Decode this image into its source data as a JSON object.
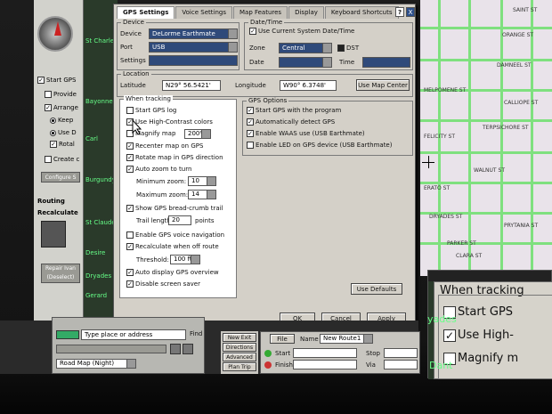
{
  "background_left": {
    "start_gps": "Start GPS",
    "provide": "Provide",
    "arrange": "Arrange",
    "keep": "Keep",
    "use_d": "Use D",
    "rotal": "Rotal",
    "create": "Create c",
    "configure": "Configure S",
    "routing": "Routing",
    "recalc": "Recalculate",
    "repair_btn": "Repair Ivan (Deselect)",
    "map_labels": [
      "St Charles",
      "Bayonne",
      "Carl",
      "Burgundy",
      "St Claude",
      "Desire",
      "Dryades",
      "Gerard"
    ]
  },
  "right_map": {
    "labels": [
      "ORANGE ST",
      "DAMNEEL ST",
      "FELICITY ST",
      "ERATO ST",
      "CLARA ST",
      "CALLIOPE ST",
      "WALNUT ST",
      "PRYTANIA ST",
      "DRYADES ST",
      "MELPOMENE ST",
      "TERPSICHORE ST",
      "SAINT ST",
      "PARKER ST"
    ]
  },
  "dialog": {
    "tabs": [
      "GPS Settings",
      "Voice Settings",
      "Map Features",
      "Display",
      "Keyboard Shortcuts"
    ],
    "help": "?",
    "close": "X",
    "device_group": "Device",
    "device_label": "Device",
    "device_value": "DeLorme Earthmate",
    "port_label": "Port",
    "port_value": "USB",
    "settings_label": "Settings",
    "datetime_group": "Date/Time",
    "use_system_time": "Use Current System Date/Time",
    "zone_label": "Zone",
    "zone_value": "Central",
    "dst_label": "DST",
    "date_label": "Date",
    "time_label": "Time",
    "location_group": "Location",
    "latitude_label": "Latitude",
    "latitude_value": "N29° 56.5421'",
    "longitude_label": "Longitude",
    "longitude_value": "W90° 6.3748'",
    "use_map_center": "Use Map Center",
    "tracking_group": "When tracking",
    "start_gps_log": "Start GPS log",
    "high_contrast": "Use High-Contrast colors",
    "magnify_map": "Magnify map",
    "magnify_value": "200%",
    "recenter": "Recenter map on GPS",
    "rotate": "Rotate map in GPS direction",
    "auto_zoom": "Auto zoom to turn",
    "min_zoom_label": "Minimum zoom:",
    "min_zoom_value": "10",
    "max_zoom_label": "Maximum zoom:",
    "max_zoom_value": "14",
    "breadcrumb": "Show GPS bread-crumb trail",
    "trail_label": "Trail length:",
    "trail_value": "20",
    "trail_unit": "points",
    "voice_nav": "Enable GPS voice navigation",
    "recalc_route": "Recalculate when off route",
    "threshold_label": "Threshold:",
    "threshold_value": "100 ft",
    "auto_overview": "Auto display GPS overview",
    "disable_saver": "Disable screen saver",
    "options_group": "GPS Options",
    "opt_start_program": "Start GPS with the program",
    "opt_auto_detect": "Automatically detect GPS",
    "opt_waas": "Enable WAAS use (USB Earthmate)",
    "opt_led": "Enable LED on GPS device (USB Earthmate)",
    "use_defaults": "Use Defaults",
    "ok": "OK",
    "cancel": "Cancel",
    "apply": "Apply"
  },
  "bottom": {
    "search_placeholder": "Type place or address",
    "find": "Find",
    "map_type": "Road Map (Night)",
    "nav_buttons": [
      "New Exit",
      "Directions",
      "Advanced",
      "Plan Trip"
    ],
    "file": "File",
    "name_label": "Name",
    "route_name": "New Route1",
    "start_label": "Start",
    "finish_label": "Finish",
    "stop_label": "Stop",
    "via_label": "Via"
  },
  "zoom_inset": {
    "title": "When tracking",
    "start_gps": "Start GPS",
    "high_contrast": "Use High-",
    "magnify": "Magnify m",
    "side_labels": [
      "yades",
      "Dant"
    ]
  }
}
